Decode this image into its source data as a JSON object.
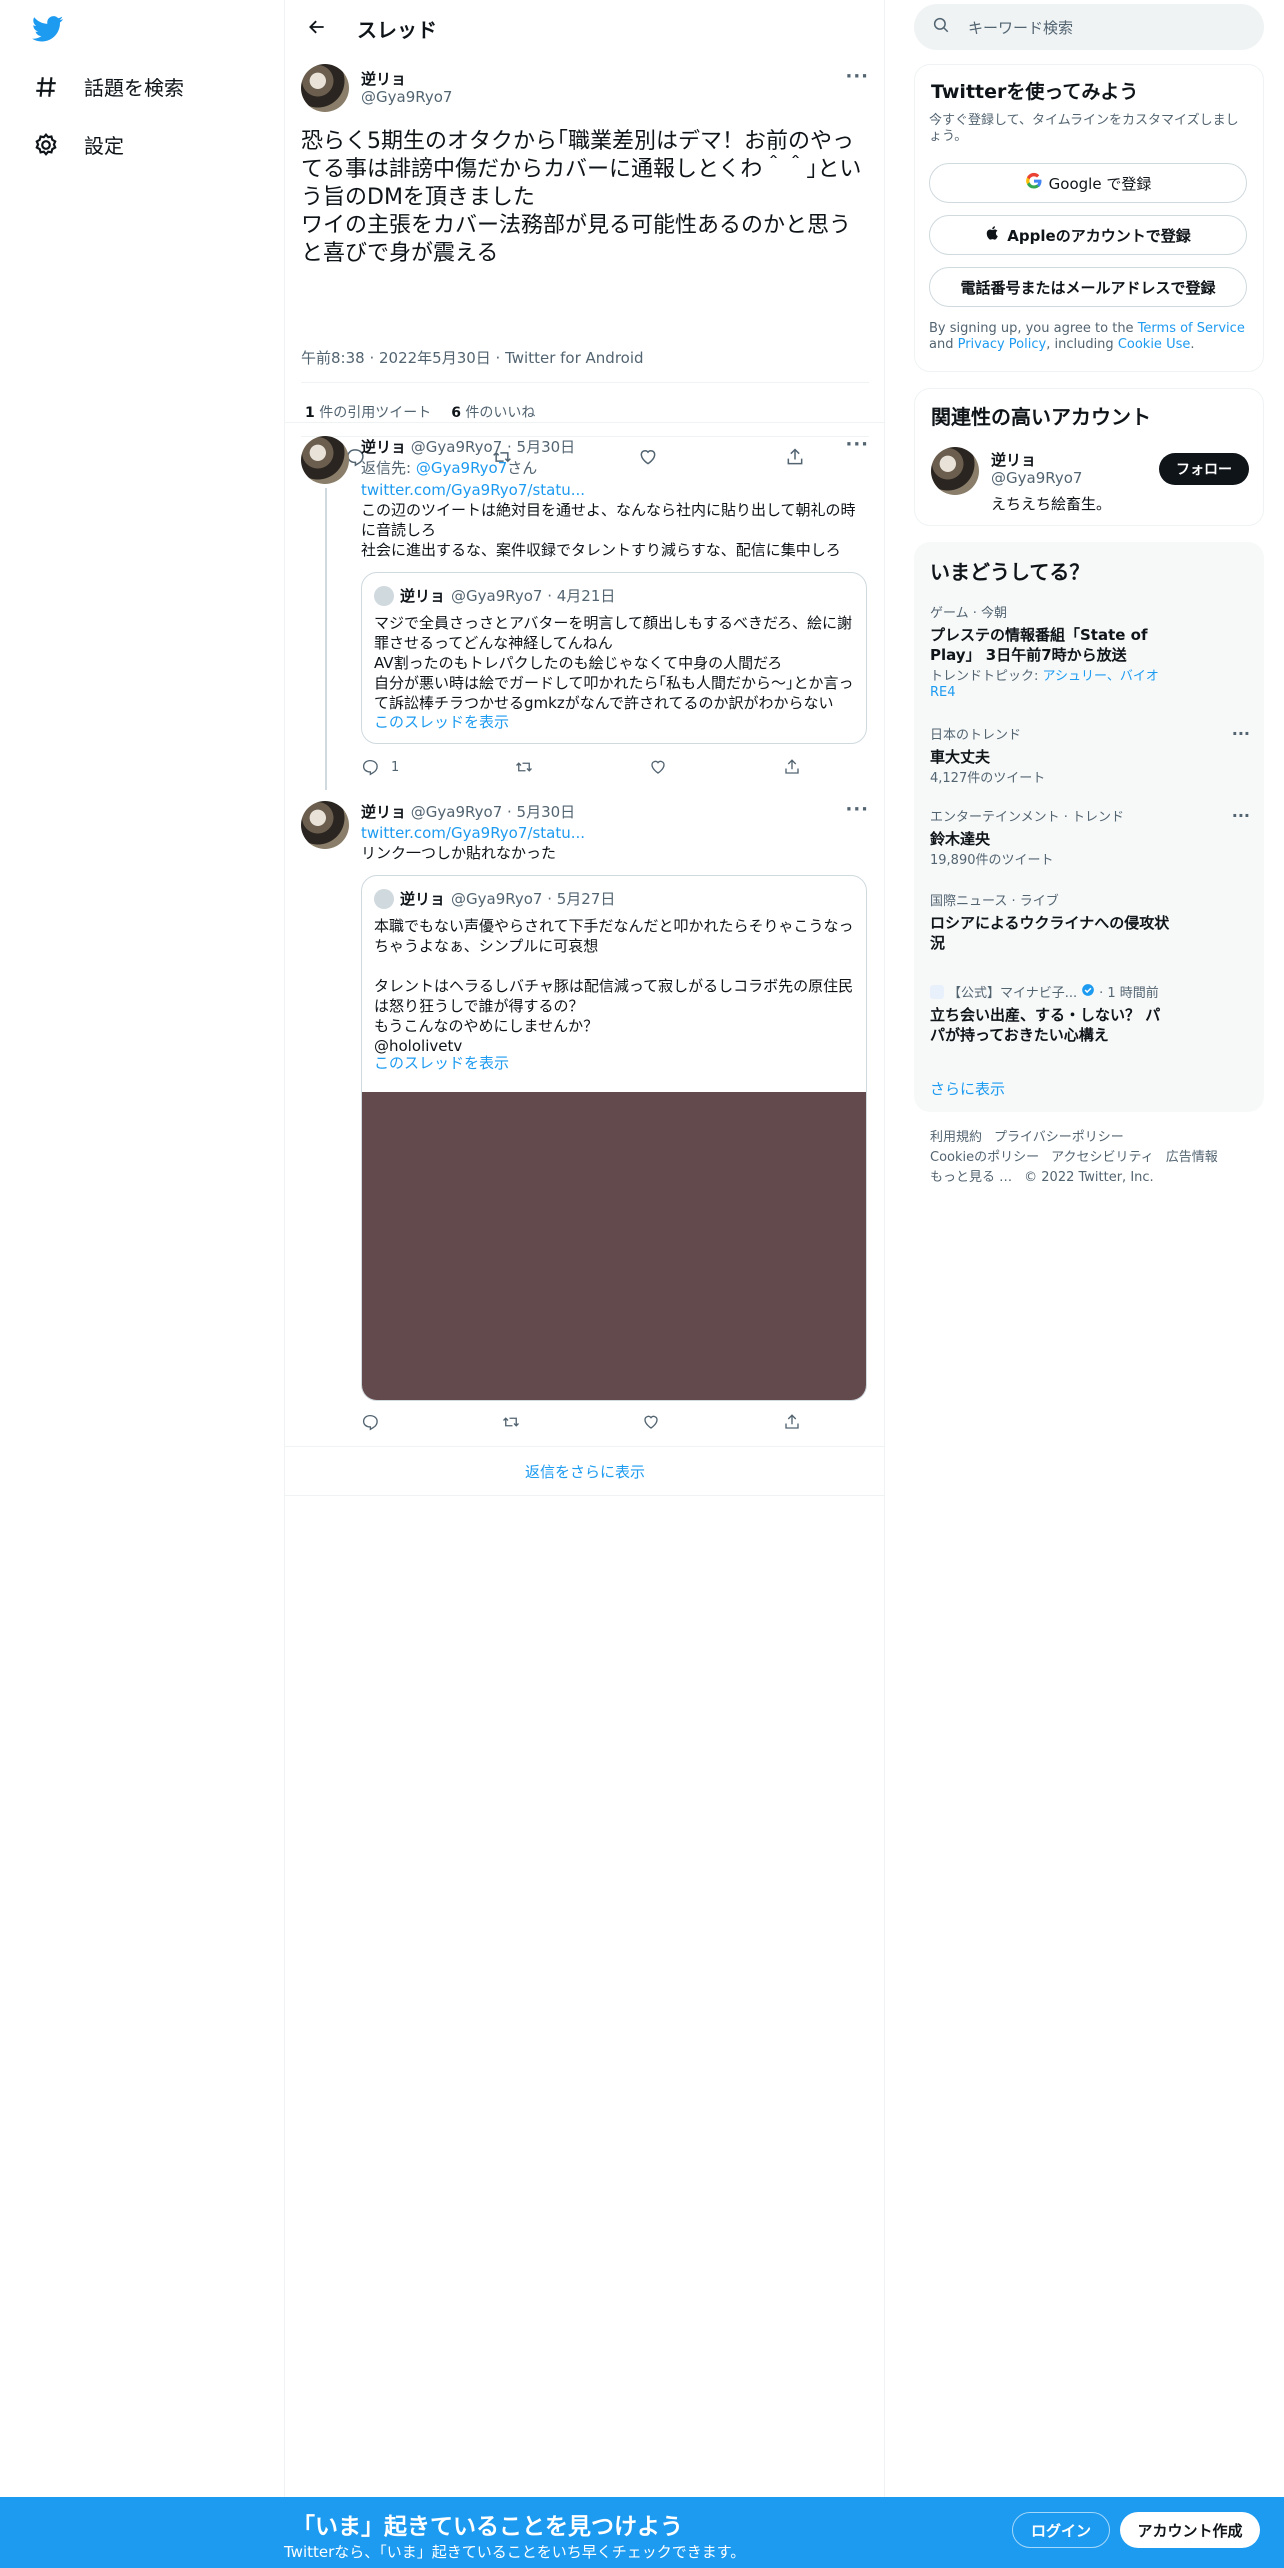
{
  "nav": {
    "explore_label": "話題を検索",
    "settings_label": "設定"
  },
  "header": {
    "title": "スレッド"
  },
  "focus_tweet": {
    "name": "逆リョ",
    "handle": "@Gya9Ryo7",
    "text": "恐らく5期生のオタクから｢職業差別はデマ！お前のやってる事は誹謗中傷だからカバーに通報しとくわ＾＾｣という旨のDMを頂きました\nワイの主張をカバー法務部が見る可能性あるのかと思うと喜びで身が震える",
    "meta": "午前8:38 · 2022年5月30日 · Twitter for Android",
    "quote_count": "1",
    "quote_label": "件の引用ツイート",
    "like_count": "6",
    "like_label": "件のいいね"
  },
  "reply1": {
    "name": "逆リョ",
    "handle_date": "@Gya9Ryo7 · 5月30日",
    "reply_to_prefix": "返信先: ",
    "reply_to_handle": "@Gya9Ryo7",
    "reply_to_suffix": "さん",
    "link": "twitter.com/Gya9Ryo7/statu...",
    "text": "この辺のツイートは絶対目を通せよ、なんなら社内に貼り出して朝礼の時に音読しろ\n社会に進出するな、案件収録でタレントすり減らすな、配信に集中しろ",
    "quote": {
      "name": "逆リョ",
      "handle_date": "@Gya9Ryo7 · 4月21日",
      "text": "マジで全員さっさとアバターを明言して顔出しもするべきだろ、絵に謝罪させるってどんな神経してんねん\nAV割ったのもトレパクしたのも絵じゃなくて中身の人間だろ\n自分が悪い時は絵でガードして叩かれたら｢私も人間だから〜｣とか言って訴訟棒チラつかせるgmkzがなんで許されてるのか訳がわからない",
      "show_thread": "このスレッドを表示"
    },
    "reply_count": "1"
  },
  "reply2": {
    "name": "逆リョ",
    "handle_date": "@Gya9Ryo7 · 5月30日",
    "link": "twitter.com/Gya9Ryo7/statu...",
    "text": "リンク一つしか貼れなかった",
    "quote": {
      "name": "逆リョ",
      "handle_date": "@Gya9Ryo7 · 5月27日",
      "text": "本職でもない声優やらされて下手だなんだと叩かれたらそりゃこうなっちゃうよなぁ、シンプルに可哀想\n\nタレントはヘラるしバチャ豚は配信減って寂しがるしコラボ先の原住民は怒り狂うしで誰が得するの？\nもうこんなのやめにしませんか？\n@hololivetv",
      "show_thread": "このスレッドを表示",
      "media_color": "#634a4d"
    }
  },
  "show_more_replies": "返信をさらに表示",
  "right": {
    "search_placeholder": "キーワード検索",
    "signup_card": {
      "title": "Twitterを使ってみよう",
      "desc": "今すぐ登録して、タイムラインをカスタマイズしましょう。",
      "google_btn": "Google で登録",
      "apple_btn": "Appleのアカウントで登録",
      "phone_btn": "電話番号またはメールアドレスで登録",
      "terms_prefix": "By signing up, you agree to the ",
      "terms_link": "Terms of Service",
      "terms_and": " and ",
      "privacy_link": "Privacy Policy",
      "terms_including": ", including ",
      "cookie_link": "Cookie Use",
      "terms_end": "."
    },
    "related_card": {
      "title": "関連性の高いアカウント",
      "name": "逆リョ",
      "handle": "@Gya9Ryo7",
      "bio": "えちえち絵畜生。",
      "follow_btn": "フォロー"
    },
    "trends": {
      "title": "いまどうしてる？",
      "items": [
        {
          "cat": "ゲーム · 今朝",
          "title": "プレステの情報番組「State of Play」 3日午前7時から放送",
          "sub_prefix": "トレンドトピック: ",
          "sub_link": "アシュリー、バイオRE4"
        },
        {
          "cat": "日本のトレンド",
          "title": "車大丈夫",
          "sub": "4,127件のツイート"
        },
        {
          "cat": "エンターテインメント · トレンド",
          "title": "鈴木達央",
          "sub": "19,890件のツイート"
        },
        {
          "cat": "国際ニュース · ライブ",
          "title": "ロシアによるウクライナへの侵攻状況"
        },
        {
          "cat_author": "【公式】マイナビ子...",
          "cat_time": " · 1 時間前",
          "title": "立ち会い出産、する・しない？ パパが持っておきたい心構え"
        }
      ],
      "show_more": "さらに表示"
    },
    "footer": {
      "links": [
        "利用規約",
        "プライバシーポリシー",
        "Cookieのポリシー",
        "アクセシビリティ",
        "広告情報",
        "もっと見る …"
      ],
      "copyright": "© 2022 Twitter, Inc."
    }
  },
  "bottom_bar": {
    "title": "「いま」起きていることを見つけよう",
    "subtitle": "Twitterなら、「いま」起きていることをいち早くチェックできます。",
    "login": "ログイン",
    "signup": "アカウント作成"
  },
  "colors": {
    "accent": "#1d9bf0",
    "text": "#0f1419",
    "secondary": "#536471"
  }
}
